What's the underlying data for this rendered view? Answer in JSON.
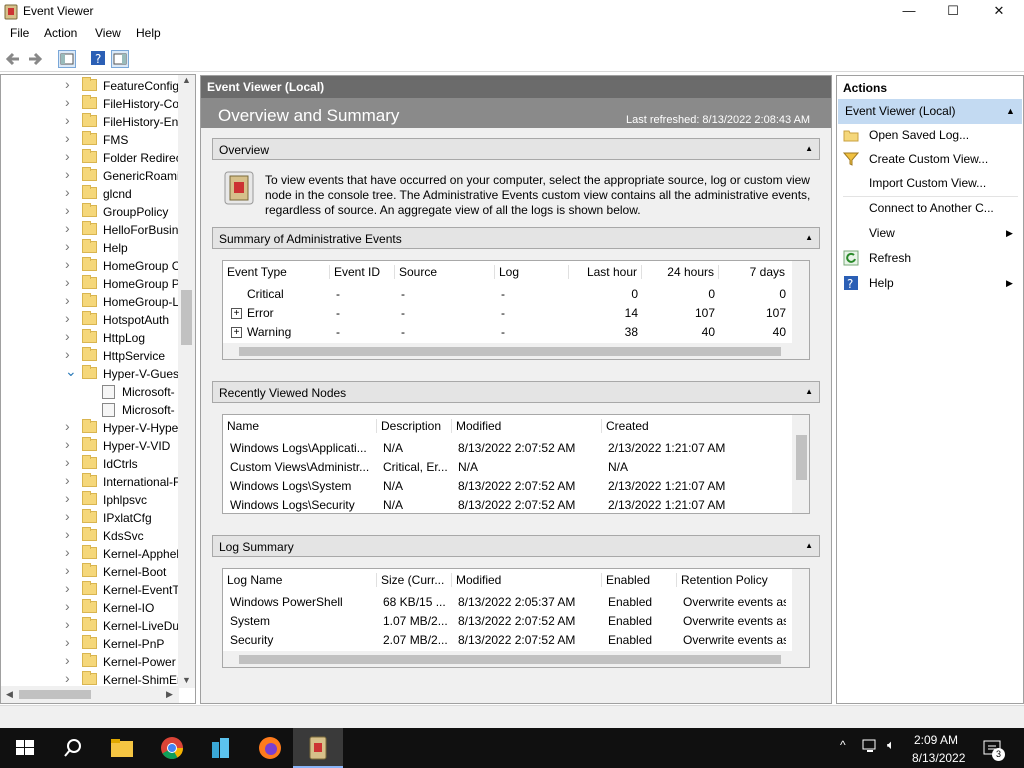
{
  "window": {
    "title": "Event Viewer",
    "min": "—",
    "max": "☐",
    "close": "✕"
  },
  "menu": [
    "File",
    "Action",
    "View",
    "Help"
  ],
  "tree": {
    "items": [
      {
        "label": "FeatureConfig"
      },
      {
        "label": "FileHistory-Co"
      },
      {
        "label": "FileHistory-Eng"
      },
      {
        "label": "FMS"
      },
      {
        "label": "Folder Redirect"
      },
      {
        "label": "GenericRoamin"
      },
      {
        "label": "glcnd"
      },
      {
        "label": "GroupPolicy"
      },
      {
        "label": "HelloForBusine"
      },
      {
        "label": "Help"
      },
      {
        "label": "HomeGroup C"
      },
      {
        "label": "HomeGroup P"
      },
      {
        "label": "HomeGroup-L"
      },
      {
        "label": "HotspotAuth"
      },
      {
        "label": "HttpLog"
      },
      {
        "label": "HttpService"
      },
      {
        "label": "Hyper-V-Guest"
      },
      {
        "label": "Microsoft-"
      },
      {
        "label": "Microsoft-"
      },
      {
        "label": "Hyper-V-Hype"
      },
      {
        "label": "Hyper-V-VID"
      },
      {
        "label": "IdCtrls"
      },
      {
        "label": "International-F"
      },
      {
        "label": "Iphlpsvc"
      },
      {
        "label": "IPxlatCfg"
      },
      {
        "label": "KdsSvc"
      },
      {
        "label": "Kernel-Apphel"
      },
      {
        "label": "Kernel-Boot"
      },
      {
        "label": "Kernel-EventTr"
      },
      {
        "label": "Kernel-IO"
      },
      {
        "label": "Kernel-LiveDur"
      },
      {
        "label": "Kernel-PnP"
      },
      {
        "label": "Kernel-Power"
      },
      {
        "label": "Kernel-ShimEr"
      }
    ]
  },
  "center": {
    "header": "Event Viewer (Local)",
    "title": "Overview and Summary",
    "last_refreshed": "Last refreshed: 8/13/2022 2:08:43 AM",
    "overview": {
      "heading": "Overview",
      "text": "To view events that have occurred on your computer, select the appropriate source, log or custom view node in the console tree. The Administrative Events custom view contains all the administrative events, regardless of source. An aggregate view of all the logs is shown below."
    },
    "admin_events": {
      "heading": "Summary of Administrative Events",
      "columns": [
        "Event Type",
        "Event ID",
        "Source",
        "Log",
        "Last hour",
        "24 hours",
        "7 days"
      ],
      "rows": [
        {
          "type": "Critical",
          "id": "-",
          "source": "-",
          "log": "-",
          "hour": "0",
          "day": "0",
          "week": "0"
        },
        {
          "type": "Error",
          "id": "-",
          "source": "-",
          "log": "-",
          "hour": "14",
          "day": "107",
          "week": "107"
        },
        {
          "type": "Warning",
          "id": "-",
          "source": "-",
          "log": "-",
          "hour": "38",
          "day": "40",
          "week": "40"
        }
      ]
    },
    "recent_nodes": {
      "heading": "Recently Viewed Nodes",
      "columns": [
        "Name",
        "Description",
        "Modified",
        "Created"
      ],
      "rows": [
        {
          "name": "Windows Logs\\Applicati...",
          "desc": "N/A",
          "modified": "8/13/2022 2:07:52 AM",
          "created": "2/13/2022 1:21:07 AM"
        },
        {
          "name": "Custom Views\\Administr...",
          "desc": "Critical, Er...",
          "modified": "N/A",
          "created": "N/A"
        },
        {
          "name": "Windows Logs\\System",
          "desc": "N/A",
          "modified": "8/13/2022 2:07:52 AM",
          "created": "2/13/2022 1:21:07 AM"
        },
        {
          "name": "Windows Logs\\Security",
          "desc": "N/A",
          "modified": "8/13/2022 2:07:52 AM",
          "created": "2/13/2022 1:21:07 AM"
        }
      ]
    },
    "log_summary": {
      "heading": "Log Summary",
      "columns": [
        "Log Name",
        "Size (Curr...",
        "Modified",
        "Enabled",
        "Retention Policy"
      ],
      "rows": [
        {
          "name": "Windows PowerShell",
          "size": "68 KB/15 ...",
          "modified": "8/13/2022 2:05:37 AM",
          "enabled": "Enabled",
          "retention": "Overwrite events as n"
        },
        {
          "name": "System",
          "size": "1.07 MB/2...",
          "modified": "8/13/2022 2:07:52 AM",
          "enabled": "Enabled",
          "retention": "Overwrite events as n"
        },
        {
          "name": "Security",
          "size": "2.07 MB/2...",
          "modified": "8/13/2022 2:07:52 AM",
          "enabled": "Enabled",
          "retention": "Overwrite events as n"
        }
      ]
    }
  },
  "actions": {
    "heading": "Actions",
    "selected": "Event Viewer (Local)",
    "items": [
      {
        "label": "Open Saved Log...",
        "icon": "open-folder-icon"
      },
      {
        "label": "Create Custom View...",
        "icon": "filter-icon"
      },
      {
        "label": "Import Custom View...",
        "icon": ""
      },
      {
        "label": "Connect to Another C...",
        "icon": ""
      },
      {
        "label": "View",
        "icon": ""
      },
      {
        "label": "Refresh",
        "icon": "refresh-icon"
      },
      {
        "label": "Help",
        "icon": "help-icon"
      }
    ]
  },
  "taskbar": {
    "time": "2:09 AM",
    "date": "8/13/2022",
    "notifications": "3"
  },
  "colors": {
    "selection": "#c3daf2",
    "header_dark": "#6b6b6b",
    "header_mid": "#8a8a8a",
    "taskbar": "#101010"
  }
}
